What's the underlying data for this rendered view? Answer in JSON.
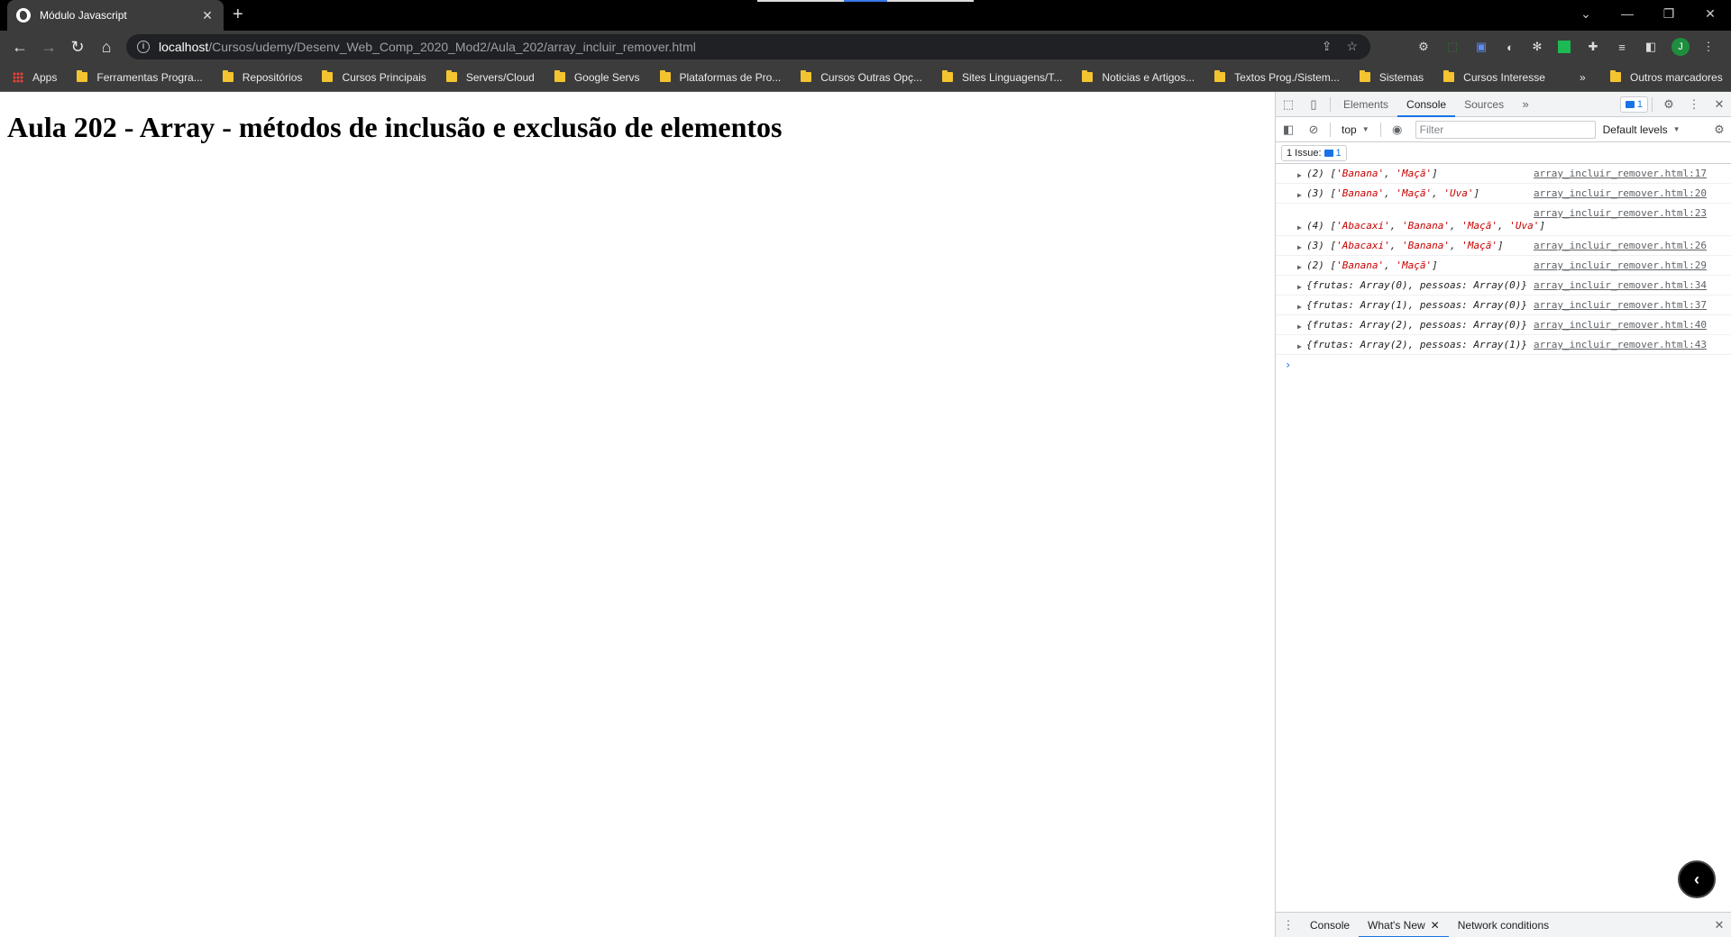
{
  "browser": {
    "tab_title": "Módulo Javascript",
    "tab_close": "✕",
    "new_tab": "+",
    "url_host": "localhost",
    "url_path": "/Cursos/udemy/Desenv_Web_Comp_2020_Mod2/Aula_202/array_incluir_remover.html",
    "profile_initial": "J",
    "bookmarks": [
      "Apps",
      "Ferramentas Progra...",
      "Repositórios",
      "Cursos Principais",
      "Servers/Cloud",
      "Google Servs",
      "Plataformas de Pro...",
      "Cursos Outras Opç...",
      "Sites Linguagens/T...",
      "Noticias e Artigos...",
      "Textos Prog./Sistem...",
      "Sistemas",
      "Cursos Interesse"
    ],
    "bookmarks_overflow": "»",
    "other_bookmarks": "Outros marcadores"
  },
  "page": {
    "heading": "Aula 202 - Array - métodos de inclusão e exclusão de elementos"
  },
  "devtools": {
    "tabs": [
      "Elements",
      "Console",
      "Sources"
    ],
    "active_tab": "Console",
    "issues_badge_count": "1",
    "context": "top",
    "filter_placeholder": "Filter",
    "levels": "Default levels",
    "issues_label": "1 Issue:",
    "issues_count": "1",
    "logs": [
      {
        "count": "(2)",
        "items": [
          "'Banana'",
          "'Maçã'"
        ],
        "source": "array_incluir_remover.html:17"
      },
      {
        "count": "(3)",
        "items": [
          "'Banana'",
          "'Maçã'",
          "'Uva'"
        ],
        "source": "array_incluir_remover.html:20"
      },
      {
        "count": "(4)",
        "items": [
          "'Abacaxi'",
          "'Banana'",
          "'Maçã'",
          "'Uva'"
        ],
        "source": "array_incluir_remover.html:23"
      },
      {
        "count": "(3)",
        "items": [
          "'Abacaxi'",
          "'Banana'",
          "'Maçã'"
        ],
        "source": "array_incluir_remover.html:26"
      },
      {
        "count": "(2)",
        "items": [
          "'Banana'",
          "'Maçã'"
        ],
        "source": "array_incluir_remover.html:29"
      },
      {
        "text": "{frutas: Array(0), pessoas: Array(0)}",
        "source": "array_incluir_remover.html:34"
      },
      {
        "text": "{frutas: Array(1), pessoas: Array(0)}",
        "source": "array_incluir_remover.html:37"
      },
      {
        "text": "{frutas: Array(2), pessoas: Array(0)}",
        "source": "array_incluir_remover.html:40"
      },
      {
        "text": "{frutas: Array(2), pessoas: Array(1)}",
        "source": "array_incluir_remover.html:43"
      }
    ],
    "prompt": "›",
    "drawer_tabs": [
      "Console",
      "What's New",
      "Network conditions"
    ],
    "drawer_active": "What's New"
  }
}
